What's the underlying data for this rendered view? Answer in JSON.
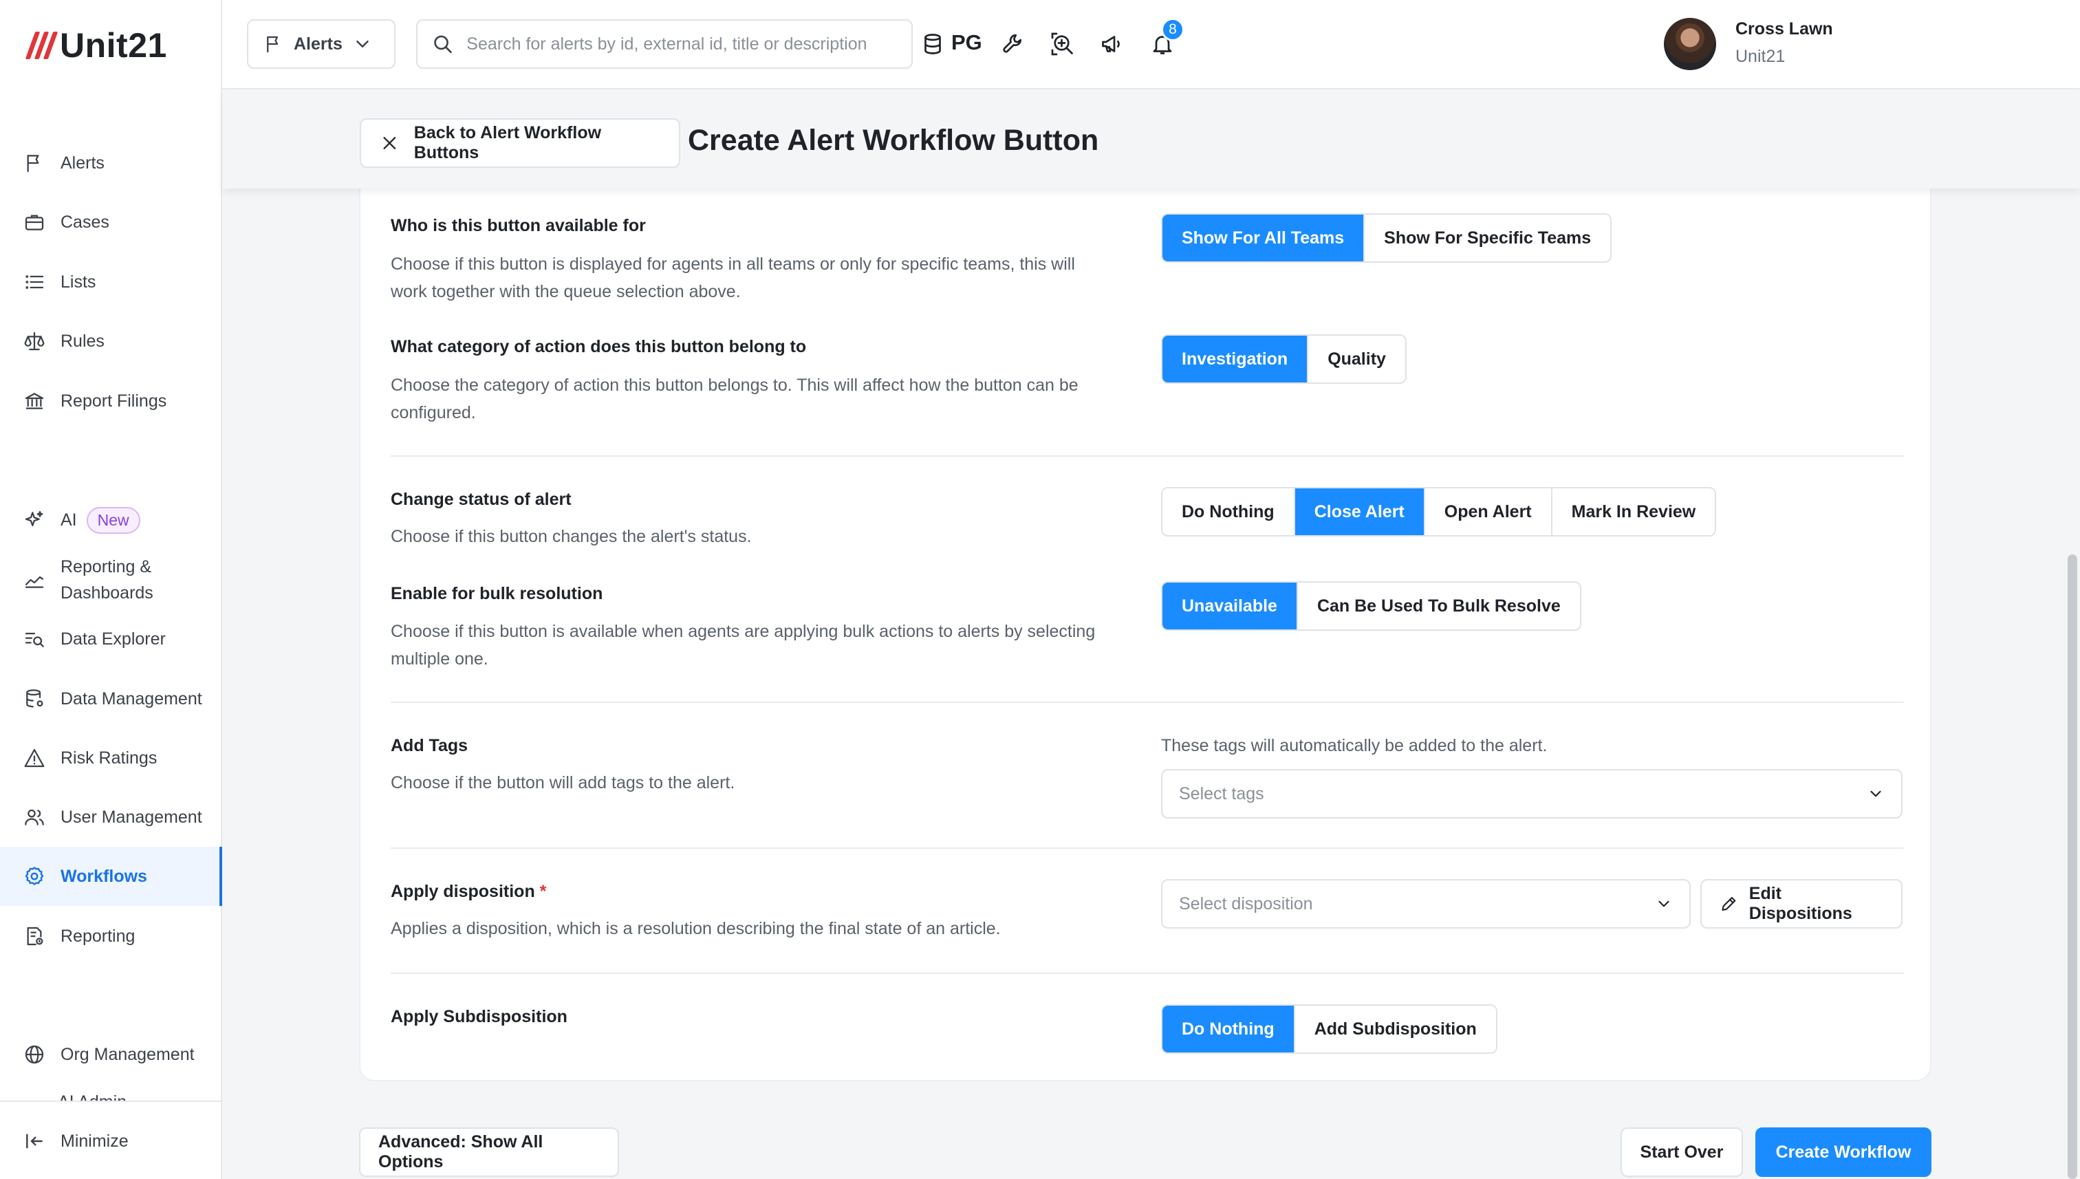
{
  "brand": {
    "logo_text": "Unit21",
    "accent": "#1a8cff",
    "logo_color": "#e0353a"
  },
  "sidebar": {
    "items": [
      {
        "label": "Alerts",
        "icon": "flag-icon"
      },
      {
        "label": "Cases",
        "icon": "briefcase-icon"
      },
      {
        "label": "Lists",
        "icon": "list-icon"
      },
      {
        "label": "Rules",
        "icon": "scale-icon"
      },
      {
        "label": "Report Filings",
        "icon": "bank-icon"
      },
      {
        "label": "AI",
        "icon": "sparkle-icon",
        "badge": "New"
      },
      {
        "label": "Reporting & Dashboards",
        "icon": "chart-line-icon"
      },
      {
        "label": "Data Explorer",
        "icon": "data-search-icon"
      },
      {
        "label": "Data Management",
        "icon": "database-icon"
      },
      {
        "label": "Risk Ratings",
        "icon": "warning-icon"
      },
      {
        "label": "User Management",
        "icon": "users-icon"
      },
      {
        "label": "Workflows",
        "icon": "gear-icon",
        "active": true
      },
      {
        "label": "Reporting",
        "icon": "report-icon"
      },
      {
        "label": "Org Management",
        "icon": "globe-icon"
      },
      {
        "label": "AI Admin",
        "icon": "none"
      }
    ],
    "minimize_label": "Minimize"
  },
  "topbar": {
    "module_dropdown": "Alerts",
    "search_placeholder": "Search for alerts by id, external id, title or description",
    "env_label": "PG",
    "notification_count": "8",
    "user_name": "Cross Lawn",
    "user_org": "Unit21"
  },
  "header": {
    "back_label": "Back to Alert Workflow Buttons",
    "title": "Create Alert Workflow Button"
  },
  "form": {
    "availability": {
      "title": "Who is this button available for",
      "desc": "Choose if this button is displayed for agents in all teams or only for specific teams, this will work together with the queue selection above.",
      "options": [
        "Show For All Teams",
        "Show For Specific Teams"
      ],
      "selected": "Show For All Teams"
    },
    "category": {
      "title": "What category of action does this button belong to",
      "desc": "Choose the category of action this button belongs to. This will affect how the button can be configured.",
      "options": [
        "Investigation",
        "Quality"
      ],
      "selected": "Investigation"
    },
    "status": {
      "title": "Change status of alert",
      "desc": "Choose if this button changes the alert's status.",
      "options": [
        "Do Nothing",
        "Close Alert",
        "Open Alert",
        "Mark In Review"
      ],
      "selected": "Close Alert"
    },
    "bulk": {
      "title": "Enable for bulk resolution",
      "desc": "Choose if this button is available when agents are applying bulk actions to alerts by selecting multiple one.",
      "options": [
        "Unavailable",
        "Can Be Used To Bulk Resolve"
      ],
      "selected": "Unavailable"
    },
    "tags": {
      "title": "Add Tags",
      "desc": "Choose if the button will add tags to the alert.",
      "helper": "These tags will automatically be added to the alert.",
      "placeholder": "Select tags"
    },
    "disposition": {
      "title": "Apply disposition",
      "required_mark": "*",
      "desc": "Applies a disposition, which is a resolution describing the final state of an article.",
      "placeholder": "Select disposition",
      "edit_label": "Edit Dispositions"
    },
    "subdisposition": {
      "title": "Apply Subdisposition",
      "options": [
        "Do Nothing",
        "Add Subdisposition"
      ],
      "selected": "Do Nothing"
    }
  },
  "footer": {
    "advanced_label": "Advanced: Show All Options",
    "start_over_label": "Start Over",
    "create_label": "Create Workflow"
  }
}
